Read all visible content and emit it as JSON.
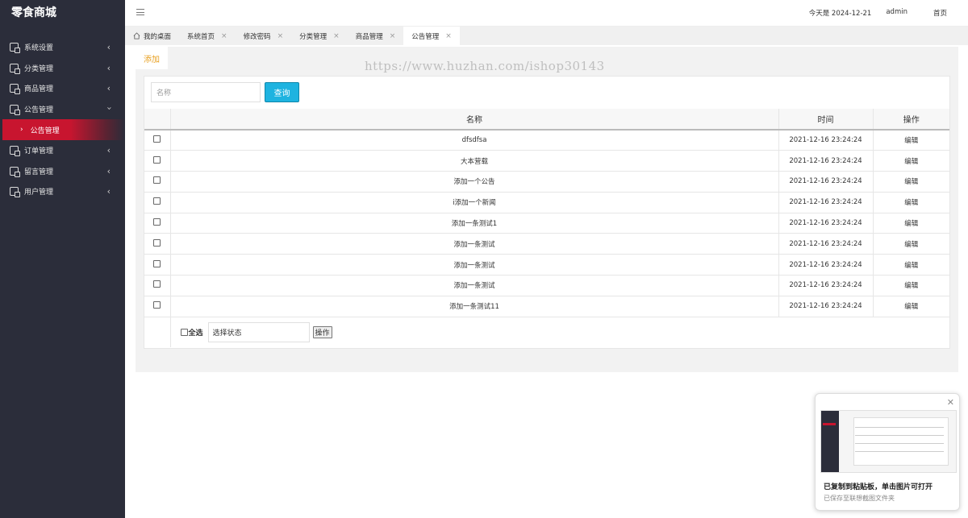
{
  "app": {
    "title": "零食商城"
  },
  "sidebar": {
    "items": [
      {
        "label": "系统设置",
        "icon": "document-icon",
        "expanded": false
      },
      {
        "label": "分类管理",
        "icon": "document-icon",
        "expanded": false
      },
      {
        "label": "商品管理",
        "icon": "document-icon",
        "expanded": false
      },
      {
        "label": "公告管理",
        "icon": "document-icon",
        "expanded": true
      },
      {
        "label": "订单管理",
        "icon": "document-icon",
        "expanded": false
      },
      {
        "label": "留言管理",
        "icon": "document-icon",
        "expanded": false
      },
      {
        "label": "用户管理",
        "icon": "document-icon",
        "expanded": false
      }
    ],
    "active_sub": {
      "label": "公告管理"
    },
    "accent_color": "#c8152f"
  },
  "header": {
    "date_text": "今天是 2024-12-21",
    "user": "admin",
    "home_link": "首页"
  },
  "tabs": [
    {
      "label": "我的桌面",
      "closable": false
    },
    {
      "label": "系统首页",
      "closable": true
    },
    {
      "label": "修改密码",
      "closable": true
    },
    {
      "label": "分类管理",
      "closable": true
    },
    {
      "label": "商品管理",
      "closable": true
    },
    {
      "label": "公告管理",
      "closable": true,
      "active": true
    }
  ],
  "toolbar": {
    "add_label": "添加"
  },
  "search": {
    "placeholder": "名称",
    "button_label": "查询"
  },
  "table": {
    "columns": [
      "名称",
      "时间",
      "操作"
    ],
    "rows": [
      {
        "name": "dfsdfsa",
        "time": "2021-12-16 23:24:24",
        "action": "编辑"
      },
      {
        "name": "大本营载",
        "time": "2021-12-16 23:24:24",
        "action": "编辑"
      },
      {
        "name": "添加一个公告",
        "time": "2021-12-16 23:24:24",
        "action": "编辑"
      },
      {
        "name": "i添加一个新闻",
        "time": "2021-12-16 23:24:24",
        "action": "编辑"
      },
      {
        "name": "添加一条测试1",
        "time": "2021-12-16 23:24:24",
        "action": "编辑"
      },
      {
        "name": "添加一条测试",
        "time": "2021-12-16 23:24:24",
        "action": "编辑"
      },
      {
        "name": "添加一条测试",
        "time": "2021-12-16 23:24:24",
        "action": "编辑"
      },
      {
        "name": "添加一条测试",
        "time": "2021-12-16 23:24:24",
        "action": "编辑"
      },
      {
        "name": "添加一条测试11",
        "time": "2021-12-16 23:24:24",
        "action": "编辑"
      }
    ],
    "footer": {
      "select_all_label": "全选",
      "status_placeholder": "选择状态",
      "operate_label": "操作"
    }
  },
  "watermark": {
    "text": "https://www.huzhan.com/ishop30143"
  },
  "toast": {
    "title": "已复制到粘贴板，单击图片可打开",
    "subtitle": "已保存至联想截图文件夹"
  },
  "colors": {
    "search_button": "#1eb3e0",
    "add_label": "#e8a020",
    "sidebar_bg": "#2b2d3a"
  }
}
